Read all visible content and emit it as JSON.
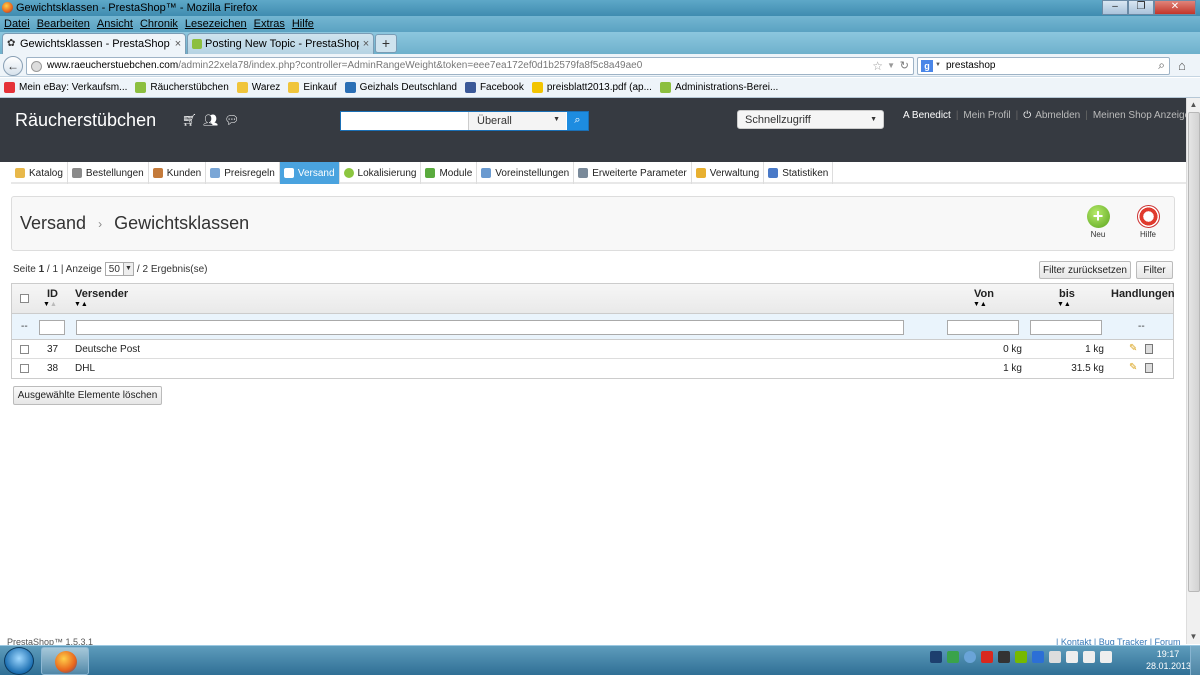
{
  "window": {
    "title": "Gewichtsklassen - PrestaShop™ - Mozilla Firefox"
  },
  "menu": [
    "Datei",
    "Bearbeiten",
    "Ansicht",
    "Chronik",
    "Lesezeichen",
    "Extras",
    "Hilfe"
  ],
  "tabs": [
    {
      "label": "Gewichtsklassen - PrestaShop™"
    },
    {
      "label": "Posting New Topic - PrestaShop Foru..."
    }
  ],
  "nav": {
    "url_domain": "www.raeucherstuebchen.com",
    "url_path": "/admin22xela78/index.php?controller=AdminRangeWeight&token=eee7ea172ef0d1b2579fa8f5c8a49ae0",
    "search_value": "prestashop"
  },
  "bookmarks": [
    {
      "label": "Mein eBay: Verkaufsm...",
      "color": "#e53238"
    },
    {
      "label": "Räucherstübchen",
      "color": "#8cbf3f"
    },
    {
      "label": "Warez",
      "color": "#f0c53b"
    },
    {
      "label": "Einkauf",
      "color": "#f0c53b"
    },
    {
      "label": "Geizhals Deutschland",
      "color": "#2a6fb5"
    },
    {
      "label": "Facebook",
      "color": "#3b5998"
    },
    {
      "label": "preisblatt2013.pdf (ap...",
      "color": "#f2c400"
    },
    {
      "label": "Administrations-Berei...",
      "color": "#8cbf3f"
    }
  ],
  "header": {
    "shop_name": "Räucherstübchen",
    "search_scope": "Überall",
    "quick_access": "Schnellzugriff",
    "user": "A Benedict",
    "profile": "Mein Profil",
    "logout": "Abmelden",
    "view_shop": "Meinen Shop Anzeigen"
  },
  "module_tabs": [
    {
      "label": "Katalog",
      "color": "#e8b84a"
    },
    {
      "label": "Bestellungen",
      "color": "#8a8a8a"
    },
    {
      "label": "Kunden",
      "color": "#c47a3a"
    },
    {
      "label": "Preisregeln",
      "color": "#7aa6d6"
    },
    {
      "label": "Versand",
      "color": "#ffffff",
      "active": true
    },
    {
      "label": "Lokalisierung",
      "color": "#8cc63f"
    },
    {
      "label": "Module",
      "color": "#5aab3e"
    },
    {
      "label": "Voreinstellungen",
      "color": "#6a9ad0"
    },
    {
      "label": "Erweiterte Parameter",
      "color": "#7a8a9a"
    },
    {
      "label": "Verwaltung",
      "color": "#e8b030"
    },
    {
      "label": "Statistiken",
      "color": "#4a7ac8"
    }
  ],
  "page": {
    "breadcrumb_parent": "Versand",
    "breadcrumb_current": "Gewichtsklassen",
    "new_label": "Neu",
    "help_label": "Hilfe"
  },
  "pager": {
    "page_label": "Seite",
    "page_current": "1",
    "page_total": "/ 1",
    "display_label": "| Anzeige",
    "per_page": "50",
    "results": "/ 2 Ergebnis(se)"
  },
  "filter_buttons": {
    "reset": "Filter zurücksetzen",
    "filter": "Filter"
  },
  "table": {
    "headers": {
      "id": "ID",
      "carrier": "Versender",
      "from": "Von",
      "to": "bis",
      "actions": "Handlungen"
    },
    "filter_dash": "--",
    "rows": [
      {
        "id": "37",
        "carrier": "Deutsche Post",
        "from": "0 kg",
        "to": "1 kg"
      },
      {
        "id": "38",
        "carrier": "DHL",
        "from": "1 kg",
        "to": "31.5 kg"
      }
    ]
  },
  "bulk_delete": "Ausgewählte Elemente löschen",
  "footer": {
    "version": "PrestaShop™ 1.5.3.1",
    "links": "| Kontakt | Bug Tracker | Forum"
  },
  "taskbar": {
    "time": "19:17",
    "date": "28.01.2013"
  }
}
